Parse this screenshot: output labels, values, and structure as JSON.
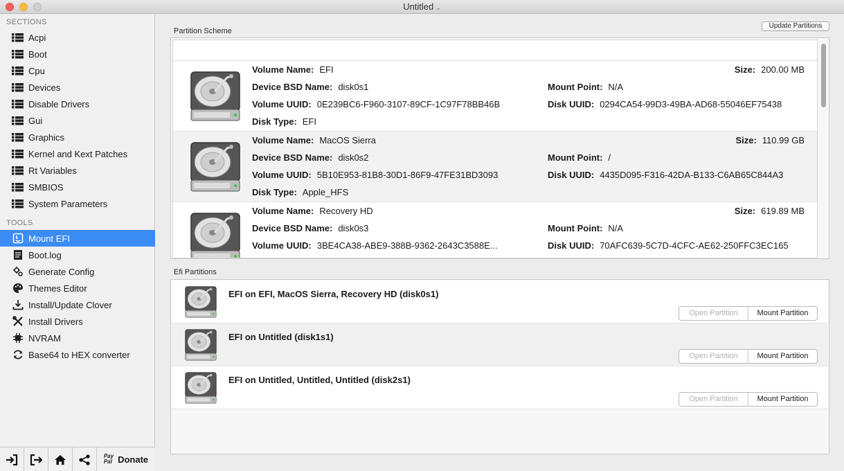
{
  "window": {
    "title": "Untitled"
  },
  "sidebar": {
    "sections_heading": "SECTIONS",
    "tools_heading": "TOOLS",
    "sections": [
      {
        "label": "Acpi",
        "icon": "list-icon"
      },
      {
        "label": "Boot",
        "icon": "list-icon"
      },
      {
        "label": "Cpu",
        "icon": "list-icon"
      },
      {
        "label": "Devices",
        "icon": "list-icon"
      },
      {
        "label": "Disable Drivers",
        "icon": "list-icon"
      },
      {
        "label": "Gui",
        "icon": "list-icon"
      },
      {
        "label": "Graphics",
        "icon": "list-icon"
      },
      {
        "label": "Kernel and Kext Patches",
        "icon": "list-icon"
      },
      {
        "label": "Rt Variables",
        "icon": "list-icon"
      },
      {
        "label": "SMBIOS",
        "icon": "list-icon"
      },
      {
        "label": "System Parameters",
        "icon": "list-icon"
      }
    ],
    "tools": [
      {
        "label": "Mount EFI",
        "icon": "finder-icon",
        "selected": true
      },
      {
        "label": "Boot.log",
        "icon": "document-icon"
      },
      {
        "label": "Generate Config",
        "icon": "gears-icon"
      },
      {
        "label": "Themes Editor",
        "icon": "palette-icon"
      },
      {
        "label": "Install/Update Clover",
        "icon": "download-icon"
      },
      {
        "label": "Install Drivers",
        "icon": "tools-icon"
      },
      {
        "label": "NVRAM",
        "icon": "chip-icon"
      },
      {
        "label": "Base64 to HEX converter",
        "icon": "refresh-icon"
      }
    ],
    "bottom": {
      "paypal_line1": "Pay",
      "paypal_line2": "Pal",
      "donate_label": "Donate"
    }
  },
  "partition_scheme": {
    "label": "Partition Scheme",
    "update_button": "Update Partitions",
    "keys": {
      "volume_name": "Volume Name:",
      "device_bsd": "Device BSD Name:",
      "volume_uuid": "Volume UUID:",
      "disk_type": "Disk Type:",
      "size": "Size:",
      "mount_point": "Mount Point:",
      "disk_uuid": "Disk UUID:"
    },
    "rows": [
      {
        "volume_name": "EFI",
        "device_bsd": "disk0s1",
        "volume_uuid": "0E239BC6-F960-3107-89CF-1C97F78BB46B",
        "disk_type": "EFI",
        "size": "200.00 MB",
        "mount_point": "N/A",
        "disk_uuid": "0294CA54-99D3-49BA-AD68-55046EF75438"
      },
      {
        "volume_name": "MacOS Sierra",
        "device_bsd": "disk0s2",
        "volume_uuid": "5B10E953-81B8-30D1-86F9-47FE31BD3093",
        "disk_type": "Apple_HFS",
        "size": "110.99 GB",
        "mount_point": "/",
        "disk_uuid": "4435D095-F316-42DA-B133-C6AB65C844A3"
      },
      {
        "volume_name": "Recovery HD",
        "device_bsd": "disk0s3",
        "volume_uuid": "3BE4CA38-ABE9-388B-9362-2643C3588E...",
        "disk_type": "",
        "size": "619.89 MB",
        "mount_point": "N/A",
        "disk_uuid": "70AFC639-5C7D-4CFC-AE62-250FFC3EC165"
      }
    ]
  },
  "efi_partitions": {
    "label": "Efi Partitions",
    "open_label": "Open Partition",
    "mount_label": "Mount Partition",
    "rows": [
      {
        "title": "EFI on EFI, MacOS Sierra, Recovery HD (disk0s1)"
      },
      {
        "title": "EFI on Untitled (disk1s1)"
      },
      {
        "title": "EFI on Untitled, Untitled, Untitled (disk2s1)"
      }
    ]
  }
}
